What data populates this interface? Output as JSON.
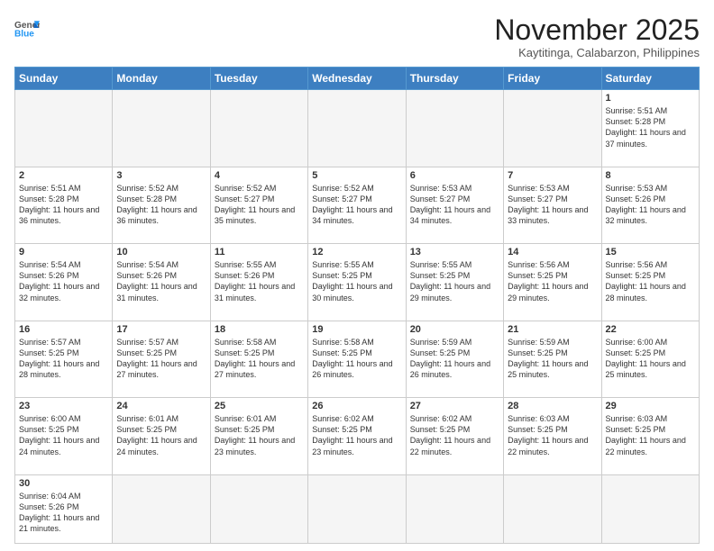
{
  "header": {
    "logo_general": "General",
    "logo_blue": "Blue",
    "month_title": "November 2025",
    "location": "Kaytitinga, Calabarzon, Philippines"
  },
  "weekdays": [
    "Sunday",
    "Monday",
    "Tuesday",
    "Wednesday",
    "Thursday",
    "Friday",
    "Saturday"
  ],
  "weeks": [
    [
      {
        "day": "",
        "empty": true
      },
      {
        "day": "",
        "empty": true
      },
      {
        "day": "",
        "empty": true
      },
      {
        "day": "",
        "empty": true
      },
      {
        "day": "",
        "empty": true
      },
      {
        "day": "",
        "empty": true
      },
      {
        "day": "1",
        "sunrise": "Sunrise: 5:51 AM",
        "sunset": "Sunset: 5:28 PM",
        "daylight": "Daylight: 11 hours and 37 minutes."
      }
    ],
    [
      {
        "day": "2",
        "sunrise": "Sunrise: 5:51 AM",
        "sunset": "Sunset: 5:28 PM",
        "daylight": "Daylight: 11 hours and 36 minutes."
      },
      {
        "day": "3",
        "sunrise": "Sunrise: 5:52 AM",
        "sunset": "Sunset: 5:28 PM",
        "daylight": "Daylight: 11 hours and 36 minutes."
      },
      {
        "day": "4",
        "sunrise": "Sunrise: 5:52 AM",
        "sunset": "Sunset: 5:27 PM",
        "daylight": "Daylight: 11 hours and 35 minutes."
      },
      {
        "day": "5",
        "sunrise": "Sunrise: 5:52 AM",
        "sunset": "Sunset: 5:27 PM",
        "daylight": "Daylight: 11 hours and 34 minutes."
      },
      {
        "day": "6",
        "sunrise": "Sunrise: 5:53 AM",
        "sunset": "Sunset: 5:27 PM",
        "daylight": "Daylight: 11 hours and 34 minutes."
      },
      {
        "day": "7",
        "sunrise": "Sunrise: 5:53 AM",
        "sunset": "Sunset: 5:27 PM",
        "daylight": "Daylight: 11 hours and 33 minutes."
      },
      {
        "day": "8",
        "sunrise": "Sunrise: 5:53 AM",
        "sunset": "Sunset: 5:26 PM",
        "daylight": "Daylight: 11 hours and 32 minutes."
      }
    ],
    [
      {
        "day": "9",
        "sunrise": "Sunrise: 5:54 AM",
        "sunset": "Sunset: 5:26 PM",
        "daylight": "Daylight: 11 hours and 32 minutes."
      },
      {
        "day": "10",
        "sunrise": "Sunrise: 5:54 AM",
        "sunset": "Sunset: 5:26 PM",
        "daylight": "Daylight: 11 hours and 31 minutes."
      },
      {
        "day": "11",
        "sunrise": "Sunrise: 5:55 AM",
        "sunset": "Sunset: 5:26 PM",
        "daylight": "Daylight: 11 hours and 31 minutes."
      },
      {
        "day": "12",
        "sunrise": "Sunrise: 5:55 AM",
        "sunset": "Sunset: 5:25 PM",
        "daylight": "Daylight: 11 hours and 30 minutes."
      },
      {
        "day": "13",
        "sunrise": "Sunrise: 5:55 AM",
        "sunset": "Sunset: 5:25 PM",
        "daylight": "Daylight: 11 hours and 29 minutes."
      },
      {
        "day": "14",
        "sunrise": "Sunrise: 5:56 AM",
        "sunset": "Sunset: 5:25 PM",
        "daylight": "Daylight: 11 hours and 29 minutes."
      },
      {
        "day": "15",
        "sunrise": "Sunrise: 5:56 AM",
        "sunset": "Sunset: 5:25 PM",
        "daylight": "Daylight: 11 hours and 28 minutes."
      }
    ],
    [
      {
        "day": "16",
        "sunrise": "Sunrise: 5:57 AM",
        "sunset": "Sunset: 5:25 PM",
        "daylight": "Daylight: 11 hours and 28 minutes."
      },
      {
        "day": "17",
        "sunrise": "Sunrise: 5:57 AM",
        "sunset": "Sunset: 5:25 PM",
        "daylight": "Daylight: 11 hours and 27 minutes."
      },
      {
        "day": "18",
        "sunrise": "Sunrise: 5:58 AM",
        "sunset": "Sunset: 5:25 PM",
        "daylight": "Daylight: 11 hours and 27 minutes."
      },
      {
        "day": "19",
        "sunrise": "Sunrise: 5:58 AM",
        "sunset": "Sunset: 5:25 PM",
        "daylight": "Daylight: 11 hours and 26 minutes."
      },
      {
        "day": "20",
        "sunrise": "Sunrise: 5:59 AM",
        "sunset": "Sunset: 5:25 PM",
        "daylight": "Daylight: 11 hours and 26 minutes."
      },
      {
        "day": "21",
        "sunrise": "Sunrise: 5:59 AM",
        "sunset": "Sunset: 5:25 PM",
        "daylight": "Daylight: 11 hours and 25 minutes."
      },
      {
        "day": "22",
        "sunrise": "Sunrise: 6:00 AM",
        "sunset": "Sunset: 5:25 PM",
        "daylight": "Daylight: 11 hours and 25 minutes."
      }
    ],
    [
      {
        "day": "23",
        "sunrise": "Sunrise: 6:00 AM",
        "sunset": "Sunset: 5:25 PM",
        "daylight": "Daylight: 11 hours and 24 minutes."
      },
      {
        "day": "24",
        "sunrise": "Sunrise: 6:01 AM",
        "sunset": "Sunset: 5:25 PM",
        "daylight": "Daylight: 11 hours and 24 minutes."
      },
      {
        "day": "25",
        "sunrise": "Sunrise: 6:01 AM",
        "sunset": "Sunset: 5:25 PM",
        "daylight": "Daylight: 11 hours and 23 minutes."
      },
      {
        "day": "26",
        "sunrise": "Sunrise: 6:02 AM",
        "sunset": "Sunset: 5:25 PM",
        "daylight": "Daylight: 11 hours and 23 minutes."
      },
      {
        "day": "27",
        "sunrise": "Sunrise: 6:02 AM",
        "sunset": "Sunset: 5:25 PM",
        "daylight": "Daylight: 11 hours and 22 minutes."
      },
      {
        "day": "28",
        "sunrise": "Sunrise: 6:03 AM",
        "sunset": "Sunset: 5:25 PM",
        "daylight": "Daylight: 11 hours and 22 minutes."
      },
      {
        "day": "29",
        "sunrise": "Sunrise: 6:03 AM",
        "sunset": "Sunset: 5:25 PM",
        "daylight": "Daylight: 11 hours and 22 minutes."
      }
    ],
    [
      {
        "day": "30",
        "sunrise": "Sunrise: 6:04 AM",
        "sunset": "Sunset: 5:26 PM",
        "daylight": "Daylight: 11 hours and 21 minutes."
      },
      {
        "day": "",
        "empty": true
      },
      {
        "day": "",
        "empty": true
      },
      {
        "day": "",
        "empty": true
      },
      {
        "day": "",
        "empty": true
      },
      {
        "day": "",
        "empty": true
      },
      {
        "day": "",
        "empty": true
      }
    ]
  ]
}
